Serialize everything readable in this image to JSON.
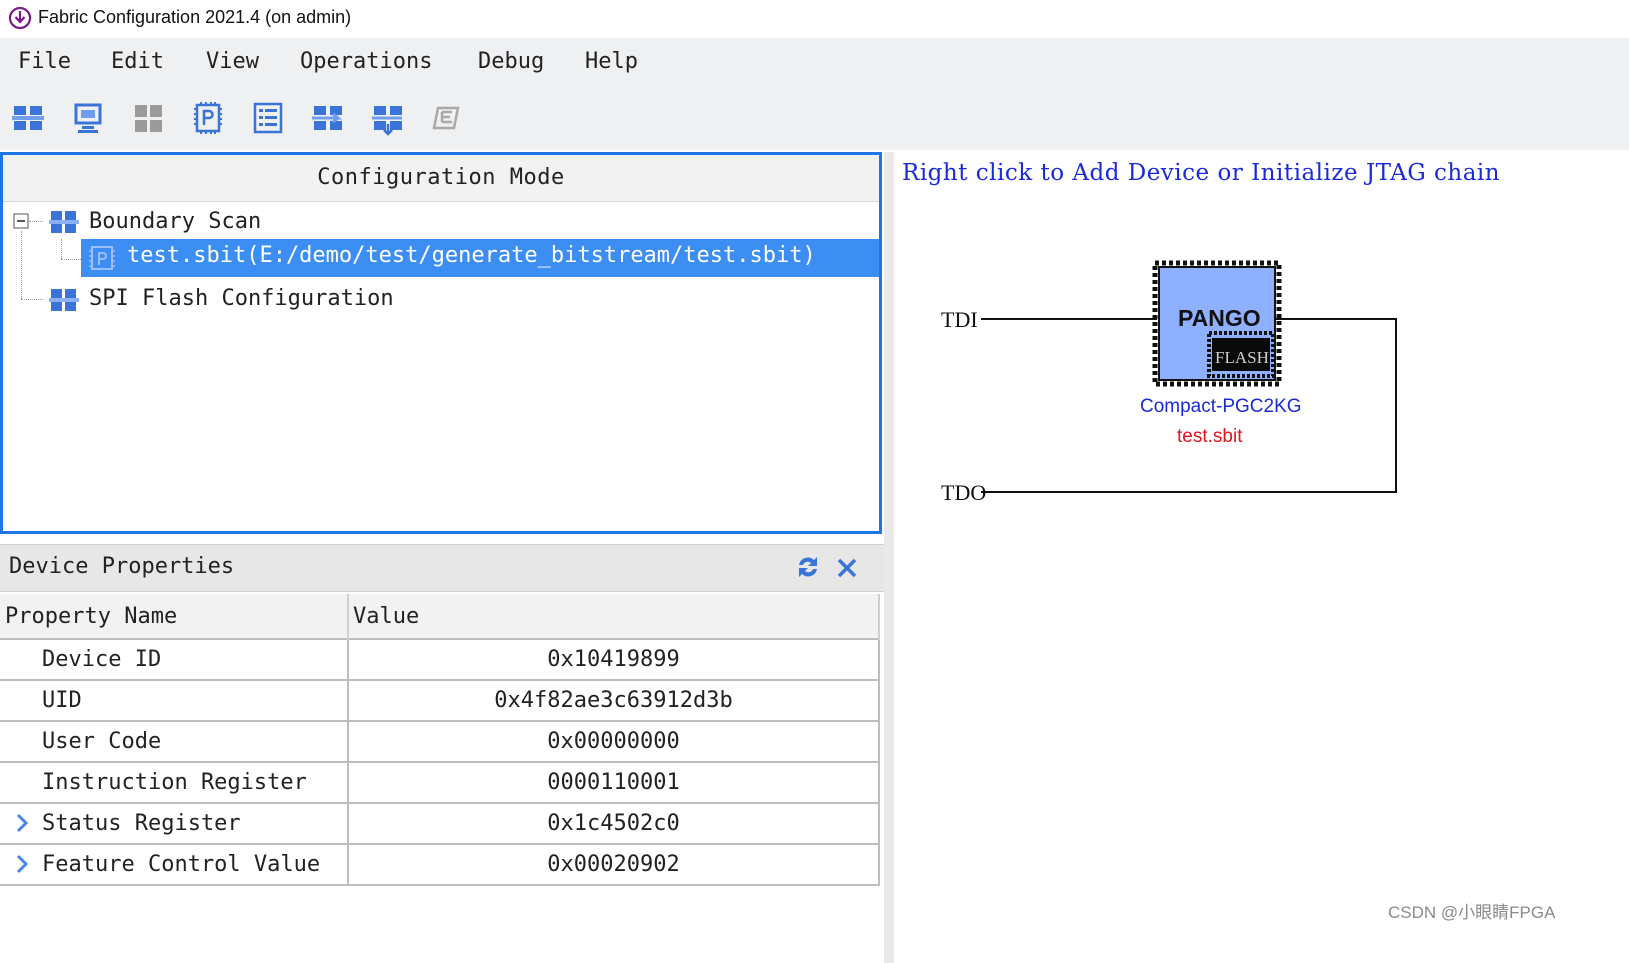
{
  "window": {
    "title": "Fabric Configuration 2021.4 (on admin)"
  },
  "menu": [
    "File",
    "Edit",
    "View",
    "Operations",
    "Debug",
    "Help"
  ],
  "toolbar": {
    "icons": [
      "boundary-scan-icon",
      "device-icon",
      "grid-icon",
      "program-icon",
      "list-icon",
      "chain-add-icon",
      "chain-download-icon",
      "erase-icon"
    ]
  },
  "config_panel": {
    "title": "Configuration Mode",
    "tree": {
      "boundary_scan": "Boundary Scan",
      "bitstream": "test.sbit(E:/demo/test/generate_bitstream/test.sbit)",
      "spi_flash": "SPI Flash Configuration"
    }
  },
  "device_properties": {
    "title": "Device Properties",
    "columns": [
      "Property Name",
      "Value"
    ],
    "rows": [
      {
        "name": "Device ID",
        "value": "0x10419899",
        "expandable": false
      },
      {
        "name": "UID",
        "value": "0x4f82ae3c63912d3b",
        "expandable": false
      },
      {
        "name": "User Code",
        "value": "0x00000000",
        "expandable": false
      },
      {
        "name": "Instruction Register",
        "value": "0000110001",
        "expandable": false
      },
      {
        "name": "Status Register",
        "value": "0x1c4502c0",
        "expandable": true
      },
      {
        "name": "Feature Control Value",
        "value": "0x00020902",
        "expandable": true
      }
    ]
  },
  "diagram": {
    "hint": "Right click to Add Device or Initialize JTAG chain",
    "tdi": "TDI",
    "tdo": "TDO",
    "chip_label": "PANGO",
    "flash_label": "FLASH",
    "device_name": "Compact-PGC2KG",
    "file_name": "test.sbit"
  },
  "watermark": "CSDN @小眼睛FPGA",
  "colors": {
    "accent": "#1f77e6",
    "selection": "#3d8ef2",
    "chip_fill": "#8fb0ff",
    "hint_text": "#1a2ad6",
    "file_text": "#e0141e"
  }
}
